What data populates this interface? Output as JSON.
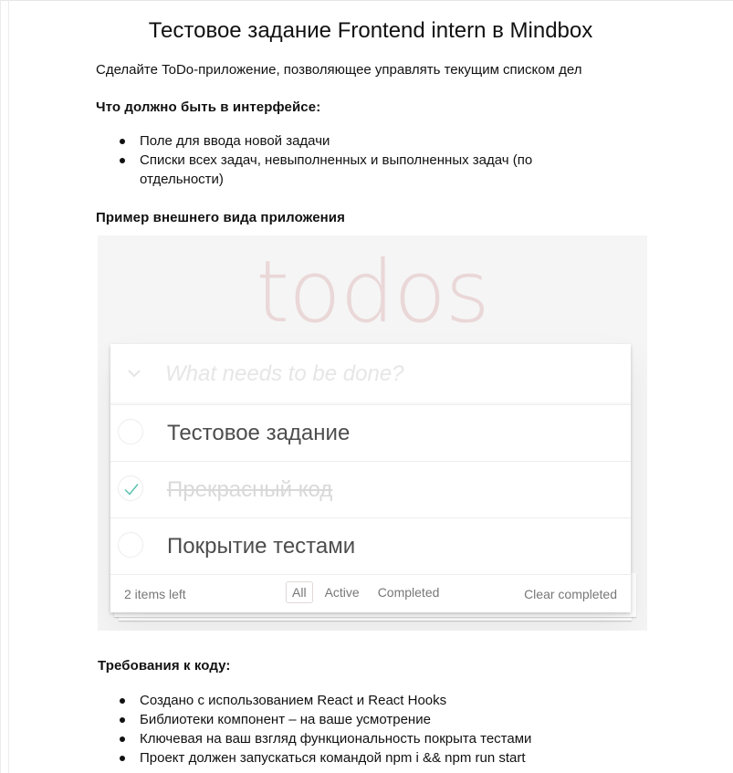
{
  "document": {
    "title": "Тестовое задание Frontend intern в Mindbox",
    "intro": "Сделайте ToDo-приложение, позволяющее управлять текущим списком дел",
    "interface_heading": "Что должно быть в интерфейсе:",
    "interface_items": [
      "Поле для ввода новой задачи",
      "Списки всех задач, невыполненных и выполненных задач (по отдельности)"
    ],
    "example_heading": "Пример внешнего вида приложения",
    "code_heading": "Требования к коду:",
    "code_items": [
      "Создано с использованием React и React Hooks",
      "Библиотеки компонент – на ваше усмотрение",
      "Ключевая на ваш взгляд функциональность покрыта тестами",
      "Проект должен запускаться командой npm i && npm run start"
    ]
  },
  "todo_app": {
    "logo": "todos",
    "input_placeholder": "What needs to be done?",
    "toggle_icon": "chevron-down-icon",
    "items": [
      {
        "label": "Тестовое задание",
        "completed": false
      },
      {
        "label": "Прекрасный код",
        "completed": true
      },
      {
        "label": "Покрытие тестами",
        "completed": false
      }
    ],
    "footer": {
      "items_left": "2 items left",
      "filters": [
        "All",
        "Active",
        "Completed"
      ],
      "selected_filter": "All",
      "clear_completed": "Clear completed"
    },
    "colors": {
      "logo": "#af2f2f",
      "check": "#5dc2af",
      "text": "#4d4d4d",
      "completed_text": "#d9d9d9",
      "background": "#f5f5f5"
    }
  }
}
